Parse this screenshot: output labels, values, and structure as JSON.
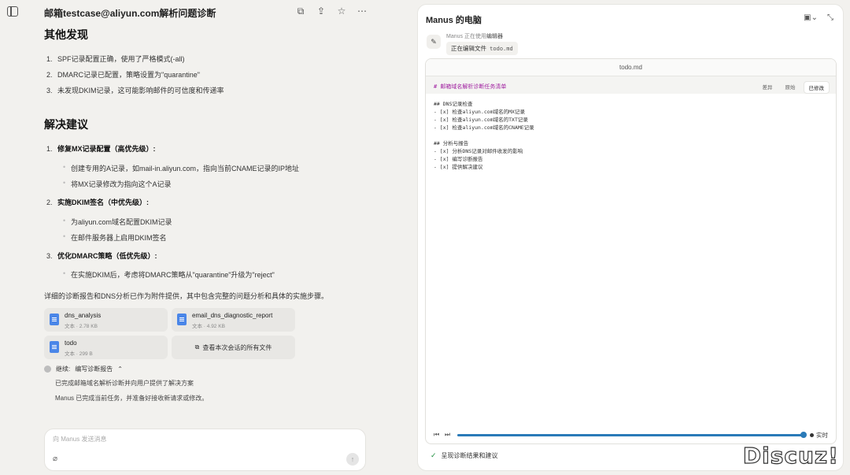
{
  "chat": {
    "title": "邮箱testcase@aliyun.com解析问题诊断",
    "other_findings_heading": "其他发现",
    "other_findings": [
      {
        "num": "1.",
        "text": "SPF记录配置正确，使用了严格模式(-all)"
      },
      {
        "num": "2.",
        "text": "DMARC记录已配置，策略设置为\"quarantine\""
      },
      {
        "num": "3.",
        "text": "未发现DKIM记录，这可能影响邮件的可信度和传递率"
      }
    ],
    "solutions_heading": "解决建议",
    "solutions": [
      {
        "num": "1.",
        "title": "修复MX记录配置（高优先级）",
        "bullets": [
          "创建专用的A记录，如mail-in.aliyun.com，指向当前CNAME记录的IP地址",
          "将MX记录修改为指向这个A记录"
        ]
      },
      {
        "num": "2.",
        "title": "实施DKIM签名（中优先级）",
        "bullets": [
          "为aliyun.com域名配置DKIM记录",
          "在邮件服务器上启用DKIM签名"
        ]
      },
      {
        "num": "3.",
        "title": "优化DMARC策略（低优先级）",
        "bullets": [
          "在实施DKIM后，考虑将DMARC策略从\"quarantine\"升级为\"reject\""
        ]
      }
    ],
    "colon": ":",
    "summary": "详细的诊断报告和DNS分析已作为附件提供，其中包含完整的问题分析和具体的实施步骤。",
    "files": [
      {
        "name": "dns_analysis",
        "meta": "文本 · 2.78 KB"
      },
      {
        "name": "email_dns_diagnostic_report",
        "meta": "文本 · 4.92 KB"
      },
      {
        "name": "todo",
        "meta": "文本 · 299 B"
      }
    ],
    "all_files_label": "查看本次会话的所有文件",
    "status_label": "继续:",
    "status_task": "编写诊断报告",
    "status_lines": [
      "已完成邮箱域名解析诊断并向用户提供了解决方案",
      "Manus 已完成当前任务，并准备好接收新请求或修改。"
    ],
    "composer_placeholder": "向 Manus 发送消息"
  },
  "computer": {
    "title": "Manus 的电脑",
    "using_prefix": "Manus 正在使用",
    "using_tool": "编辑器",
    "editing_label": "正在编辑文件",
    "editing_file": "todo.md",
    "viewer_title": "todo.md",
    "tabs": [
      "差异",
      "原始",
      "已修改"
    ],
    "doc_heading": "# 邮箱域名解析诊断任务清单",
    "sections": [
      {
        "heading": "## DNS记录检查",
        "items": [
          "- [x] 检查aliyun.com域名的MX记录",
          "- [x] 检查aliyun.com域名的TXT记录",
          "- [x] 检查aliyun.com域名的CNAME记录"
        ]
      },
      {
        "heading": "## 分析与报告",
        "items": [
          "- [x] 分析DNS记录对邮件收发的影响",
          "- [x] 编写诊断报告",
          "- [x] 提供解决建议"
        ]
      }
    ],
    "live_label": "实时",
    "result_label": "呈现诊断结果和建议",
    "progress": 1.0
  },
  "watermark": "Discuz!",
  "icons": {
    "sidebar": "sidebar-toggle-icon",
    "file": "document-icon",
    "send": "arrow-up-icon",
    "clip": "paperclip-icon"
  }
}
